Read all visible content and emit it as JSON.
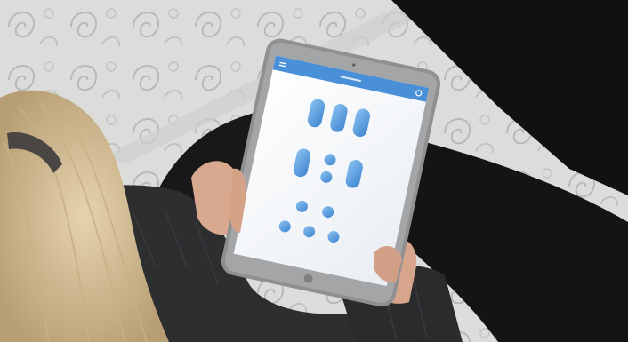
{
  "scene": {
    "description_key": "photo-tablet-remote-app",
    "colors": {
      "mattress": "#d9d9d7",
      "mattress_pattern": "#b7b7b5",
      "sofa": "#151515",
      "sweater": "#2b2c2e",
      "hair": "#d8c29a",
      "skin": "#d9a98f",
      "tablet_frame": "#8f9091",
      "tablet_screen": "#f4f7fa",
      "app_header": "#4a90d9",
      "button_blue": "#4f95dc"
    }
  },
  "tablet_app": {
    "header_title": "",
    "header_left_icon": "menu-icon",
    "header_right_icon": "settings-icon"
  }
}
